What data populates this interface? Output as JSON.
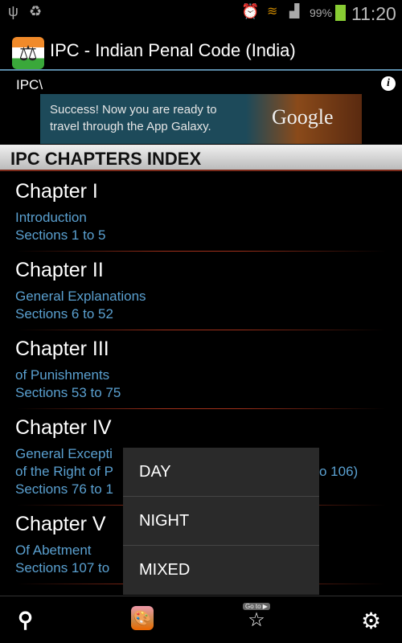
{
  "status_bar": {
    "battery": "99%",
    "time": "11:20",
    "icons": [
      "usb-icon",
      "recycle-icon",
      "alarm-icon",
      "wifi-icon",
      "signal-icon",
      "battery-charging-icon"
    ]
  },
  "app": {
    "title": "IPC - Indian Penal Code (India)",
    "path": "IPC\\"
  },
  "ad": {
    "text_line1": "Success! Now you are ready to",
    "text_line2": "travel through the App Galaxy.",
    "brand": "Google"
  },
  "index_header": "IPC CHAPTERS INDEX",
  "chapters": [
    {
      "title": "Chapter I",
      "lines": [
        "Introduction",
        "Sections 1 to 5"
      ]
    },
    {
      "title": "Chapter II",
      "lines": [
        "General Explanations",
        "Sections 6 to 52"
      ]
    },
    {
      "title": "Chapter III",
      "lines": [
        "of Punishments",
        "Sections 53 to 75"
      ]
    },
    {
      "title": "Chapter IV",
      "lines": [
        "General Excepti",
        "of the Right of P",
        "Sections 76 to 1"
      ],
      "line2_tail": "o 106)"
    },
    {
      "title": "Chapter V",
      "lines": [
        "Of Abetment",
        "Sections 107 to"
      ]
    }
  ],
  "theme_menu": {
    "items": [
      "DAY",
      "NIGHT",
      "MIXED"
    ]
  },
  "bottom_bar": {
    "goto_label": "Go to ▶",
    "icons": [
      "search-icon",
      "theme-palette-icon",
      "goto-star-icon",
      "settings-icon"
    ]
  },
  "colors": {
    "link": "#5aa0d0",
    "accent_line": "#5a8aa8",
    "menu_bg": "#2a2a2a"
  }
}
